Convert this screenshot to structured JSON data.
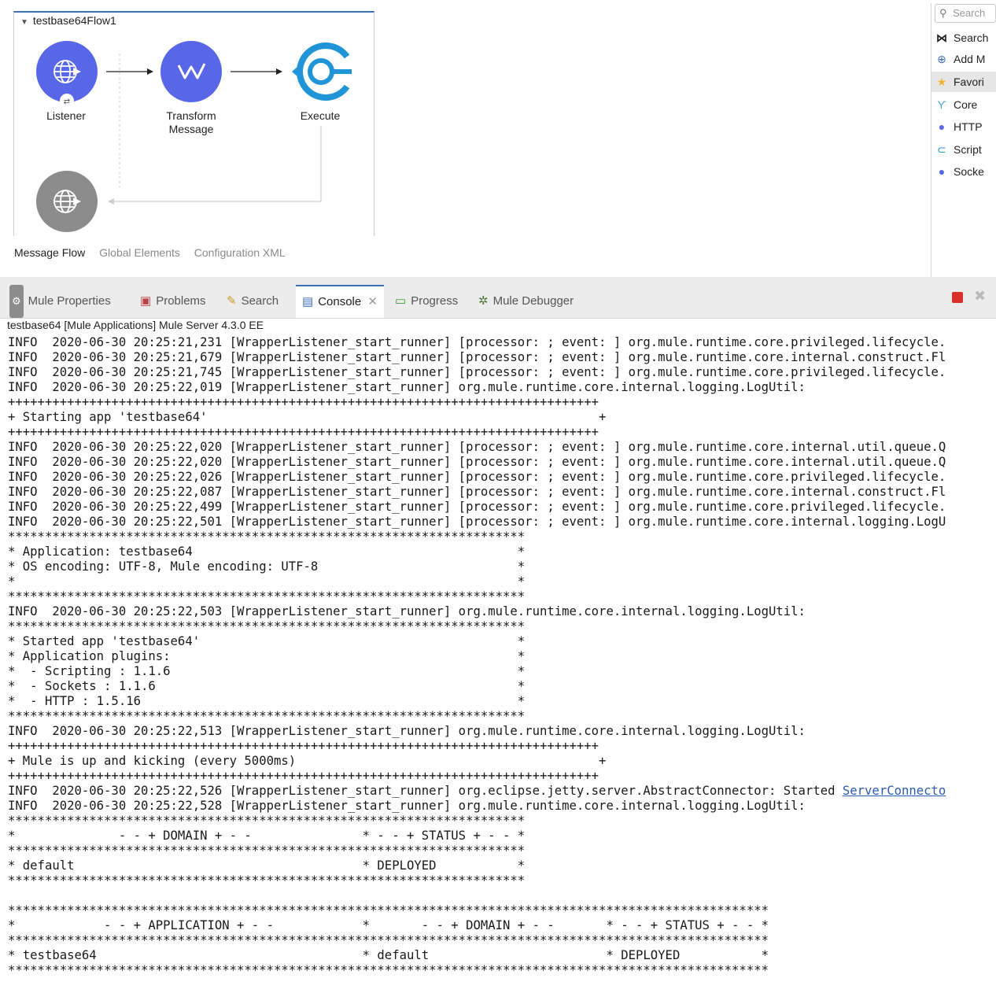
{
  "flow": {
    "title": "testbase64Flow1",
    "nodes": [
      {
        "label": "Listener",
        "icon": "globe-icon",
        "color": "#5866e8"
      },
      {
        "label": "Transform\nMessage",
        "icon": "dataweave-icon",
        "color": "#5866e8"
      },
      {
        "label": "Execute",
        "icon": "script-icon",
        "color": "#1f95d8"
      }
    ],
    "response_icon": "globe-icon",
    "response_color": "#8c8c8c"
  },
  "view_tabs": {
    "message_flow": "Message Flow",
    "global_elements": "Global Elements",
    "configuration_xml": "Configuration XML"
  },
  "palette": {
    "search_placeholder": "Search",
    "items": [
      {
        "label": "Search",
        "icon": "search-in-exchange-icon"
      },
      {
        "label": "Add M",
        "icon": "add-icon"
      },
      {
        "label": "Favori",
        "icon": "star-icon"
      },
      {
        "label": "Core",
        "icon": "core-icon"
      },
      {
        "label": "HTTP",
        "icon": "http-icon"
      },
      {
        "label": "Script",
        "icon": "script-icon"
      },
      {
        "label": "Socke",
        "icon": "sockets-icon"
      }
    ]
  },
  "panel_tabs": [
    {
      "label": "Mule Properties",
      "icon": "gear-icon"
    },
    {
      "label": "Problems",
      "icon": "problems-icon"
    },
    {
      "label": "Search",
      "icon": "search-icon"
    },
    {
      "label": "Console",
      "icon": "console-icon"
    },
    {
      "label": "Progress",
      "icon": "progress-icon"
    },
    {
      "label": "Mule Debugger",
      "icon": "bug-icon"
    }
  ],
  "console": {
    "header": "testbase64 [Mule Applications] Mule Server 4.3.0 EE",
    "link_text": "ServerConnecto",
    "lines": [
      "INFO  2020-06-30 20:25:21,231 [WrapperListener_start_runner] [processor: ; event: ] org.mule.runtime.core.privileged.lifecycle.",
      "INFO  2020-06-30 20:25:21,679 [WrapperListener_start_runner] [processor: ; event: ] org.mule.runtime.core.internal.construct.Fl",
      "INFO  2020-06-30 20:25:21,745 [WrapperListener_start_runner] [processor: ; event: ] org.mule.runtime.core.privileged.lifecycle.",
      "INFO  2020-06-30 20:25:22,019 [WrapperListener_start_runner] org.mule.runtime.core.internal.logging.LogUtil:",
      "++++++++++++++++++++++++++++++++++++++++++++++++++++++++++++++++++++++++++++++++",
      "+ Starting app 'testbase64'                                                     +",
      "++++++++++++++++++++++++++++++++++++++++++++++++++++++++++++++++++++++++++++++++",
      "INFO  2020-06-30 20:25:22,020 [WrapperListener_start_runner] [processor: ; event: ] org.mule.runtime.core.internal.util.queue.Q",
      "INFO  2020-06-30 20:25:22,020 [WrapperListener_start_runner] [processor: ; event: ] org.mule.runtime.core.internal.util.queue.Q",
      "INFO  2020-06-30 20:25:22,026 [WrapperListener_start_runner] [processor: ; event: ] org.mule.runtime.core.privileged.lifecycle.",
      "INFO  2020-06-30 20:25:22,087 [WrapperListener_start_runner] [processor: ; event: ] org.mule.runtime.core.internal.construct.Fl",
      "INFO  2020-06-30 20:25:22,499 [WrapperListener_start_runner] [processor: ; event: ] org.mule.runtime.core.privileged.lifecycle.",
      "INFO  2020-06-30 20:25:22,501 [WrapperListener_start_runner] [processor: ; event: ] org.mule.runtime.core.internal.logging.LogU",
      "**********************************************************************",
      "* Application: testbase64                                            *",
      "* OS encoding: UTF-8, Mule encoding: UTF-8                           *",
      "*                                                                    *",
      "**********************************************************************",
      "INFO  2020-06-30 20:25:22,503 [WrapperListener_start_runner] org.mule.runtime.core.internal.logging.LogUtil:",
      "**********************************************************************",
      "* Started app 'testbase64'                                           *",
      "* Application plugins:                                               *",
      "*  - Scripting : 1.1.6                                               *",
      "*  - Sockets : 1.1.6                                                 *",
      "*  - HTTP : 1.5.16                                                   *",
      "**********************************************************************",
      "INFO  2020-06-30 20:25:22,513 [WrapperListener_start_runner] org.mule.runtime.core.internal.logging.LogUtil:",
      "++++++++++++++++++++++++++++++++++++++++++++++++++++++++++++++++++++++++++++++++",
      "+ Mule is up and kicking (every 5000ms)                                         +",
      "++++++++++++++++++++++++++++++++++++++++++++++++++++++++++++++++++++++++++++++++",
      "INFO  2020-06-30 20:25:22,526 [WrapperListener_start_runner] org.eclipse.jetty.server.AbstractConnector: Started ",
      "INFO  2020-06-30 20:25:22,528 [WrapperListener_start_runner] org.mule.runtime.core.internal.logging.LogUtil:",
      "**********************************************************************",
      "*              - - + DOMAIN + - -               * - - + STATUS + - - *",
      "**********************************************************************",
      "* default                                       * DEPLOYED           *",
      "**********************************************************************",
      "",
      "*******************************************************************************************************",
      "*            - - + APPLICATION + - -            *       - - + DOMAIN + - -       * - - + STATUS + - - *",
      "*******************************************************************************************************",
      "* testbase64                                    * default                        * DEPLOYED           *",
      "*******************************************************************************************************"
    ]
  }
}
